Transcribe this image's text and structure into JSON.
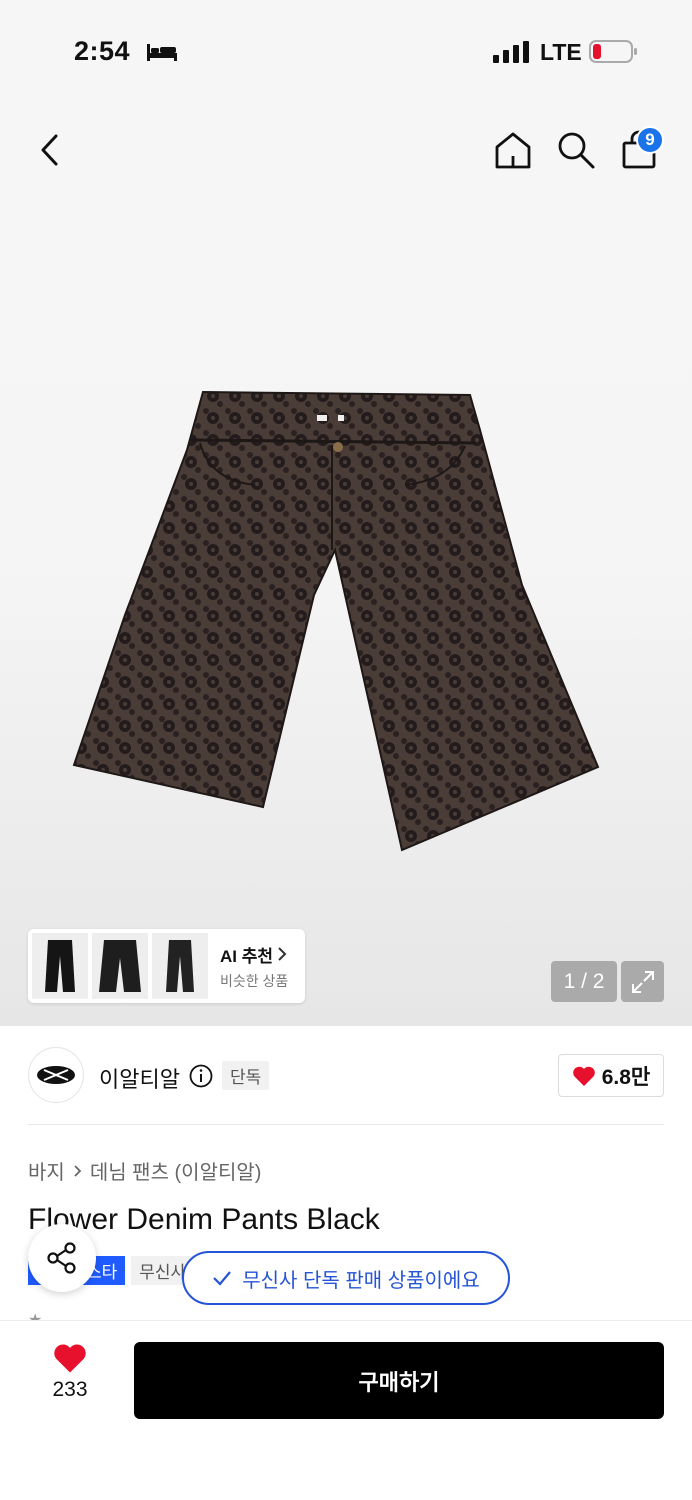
{
  "status_bar": {
    "time": "2:54",
    "network": "LTE"
  },
  "nav": {
    "cart_count": "9"
  },
  "gallery": {
    "ai_title": "AI 추천",
    "ai_subtitle": "비슷한 상품",
    "page_indicator": "1 / 2"
  },
  "brand": {
    "name": "이알티알",
    "exclusive_label": "단독",
    "likes": "6.8만"
  },
  "breadcrumb": {
    "category": "바지",
    "subcategory": "데님 팬츠 (이알티알)"
  },
  "product": {
    "title": "Flower Denim Pants Black",
    "tag_blue": "스타",
    "tag_grey": "무신사"
  },
  "toast": {
    "message": "무신사 단독 판매 상품이에요"
  },
  "bottom_bar": {
    "wish_count": "233",
    "buy_label": "구매하기"
  },
  "colors": {
    "accent_blue": "#2554d6",
    "heart_red": "#e8112d"
  }
}
